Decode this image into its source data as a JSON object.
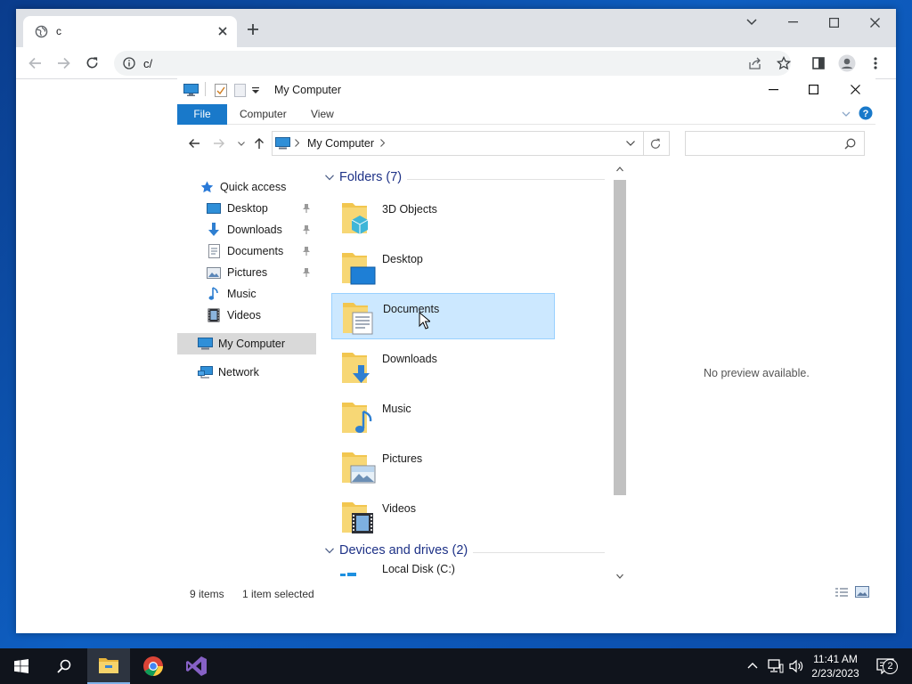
{
  "browser": {
    "tab_title": "c",
    "new_tab_label": "+",
    "url": "c/"
  },
  "explorer": {
    "title": "My Computer",
    "ribbon_tabs": [
      "File",
      "Computer",
      "View"
    ],
    "address_crumb": "My Computer",
    "nav": {
      "quick_access": "Quick access",
      "pinned": [
        {
          "label": "Desktop",
          "pinned": true
        },
        {
          "label": "Downloads",
          "pinned": true
        },
        {
          "label": "Documents",
          "pinned": true
        },
        {
          "label": "Pictures",
          "pinned": true
        },
        {
          "label": "Music",
          "pinned": false
        },
        {
          "label": "Videos",
          "pinned": false
        }
      ],
      "my_computer": "My Computer",
      "network": "Network"
    },
    "folders_header": "Folders (7)",
    "folders": [
      {
        "label": "3D Objects",
        "icon": "3d-objects-folder-icon"
      },
      {
        "label": "Desktop",
        "icon": "desktop-folder-icon"
      },
      {
        "label": "Documents",
        "icon": "documents-folder-icon",
        "selected": true
      },
      {
        "label": "Downloads",
        "icon": "downloads-folder-icon"
      },
      {
        "label": "Music",
        "icon": "music-folder-icon"
      },
      {
        "label": "Pictures",
        "icon": "pictures-folder-icon"
      },
      {
        "label": "Videos",
        "icon": "videos-folder-icon"
      }
    ],
    "drives_header": "Devices and drives (2)",
    "drives": [
      {
        "label": "Local Disk (C:)"
      }
    ],
    "preview_text": "No preview available.",
    "status_count": "9 items",
    "status_selected": "1 item selected"
  },
  "taskbar": {
    "time": "11:41 AM",
    "date": "2/23/2023",
    "notification_count": "2"
  },
  "colors": {
    "accent": "#1979ca",
    "selection_bg": "#cce8ff",
    "selection_border": "#99d1ff",
    "group_header": "#1e3287"
  }
}
